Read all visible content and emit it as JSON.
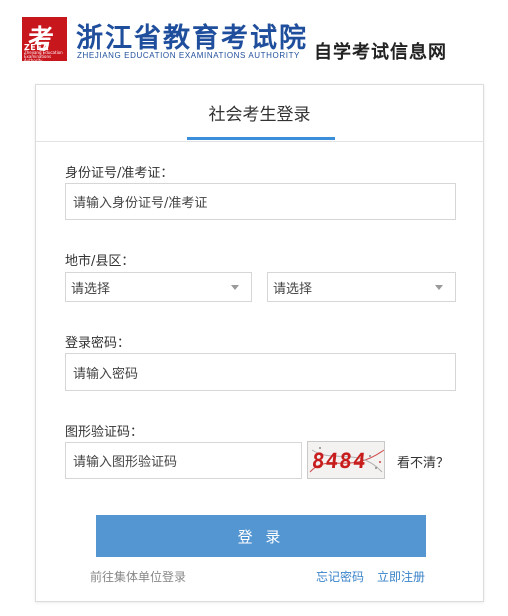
{
  "header": {
    "logo_glyph": "考",
    "logo_abbr": "ZEEA",
    "logo_small_line1": "Zhejiang Education",
    "logo_small_line2": "Examinations Authority",
    "org_name_cn": "浙江省教育考试院",
    "org_name_en": "ZHEJIANG EDUCATION EXAMINATIONS AUTHORITY",
    "watermark": "自学考试信息网"
  },
  "card": {
    "tab_title": "社会考生登录"
  },
  "form": {
    "id_label": "身份证号/准考证：",
    "id_placeholder": "请输入身份证号/准考证",
    "region_label": "地市/县区：",
    "city_select": "请选择",
    "county_select": "请选择",
    "password_label": "登录密码：",
    "password_placeholder": "请输入密码",
    "captcha_label": "图形验证码：",
    "captcha_placeholder": "请输入图形验证码",
    "captcha_code": "8484",
    "captcha_refresh": "看不清？"
  },
  "actions": {
    "login": "登 录",
    "group_login": "前往集体单位登录",
    "forgot_password": "忘记密码",
    "register": "立即注册"
  },
  "colors": {
    "logo_red": "#c8161d",
    "org_blue": "#1f4e9c",
    "tab_accent": "#3b8ed9",
    "button_blue": "#5496d1",
    "link_blue": "#3a83c9",
    "captcha_red": "#c81d1d"
  }
}
